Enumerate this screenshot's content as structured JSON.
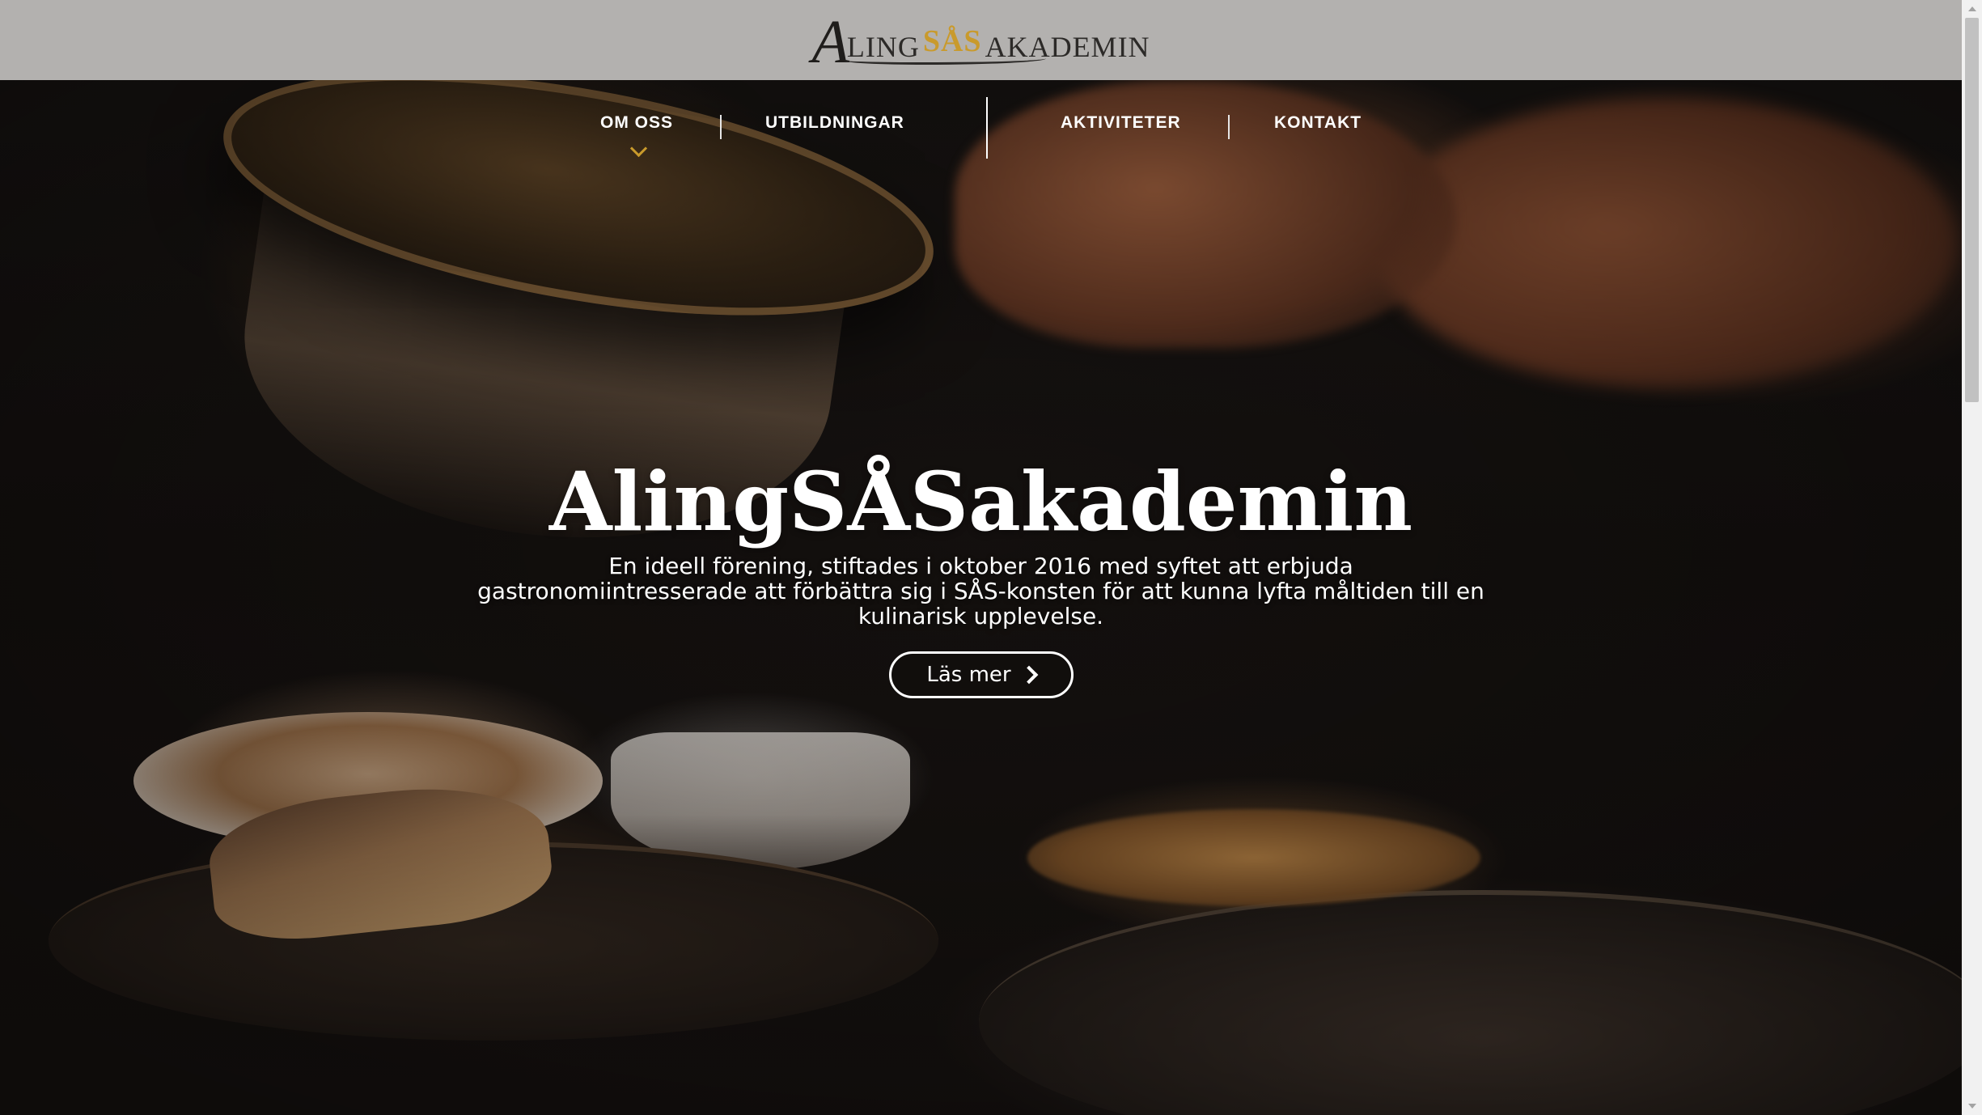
{
  "header": {
    "logo": {
      "letter_a": "A",
      "text_ling": "LING",
      "text_sas": "SÅS",
      "text_akademin": "AKADEMIN"
    }
  },
  "nav": {
    "items": [
      {
        "label": "OM OSS",
        "has_dropdown": true
      },
      {
        "label": "UTBILDNINGAR"
      },
      {
        "label": "AKTIVITETER"
      },
      {
        "label": "KONTAKT"
      }
    ]
  },
  "hero": {
    "title": "AlingSÅSakademin",
    "description": "En ideell förening, stiftades i oktober 2016 med syftet att erbjuda gastronomiintresserade att förbättra sig i SÅS-konsten för att kunna lyfta måltiden till en kulinarisk upplevelse.",
    "button_label": "Läs mer",
    "button_icon": "chevron-right-icon"
  },
  "colors": {
    "header_bg": "#b3b1af",
    "accent_gold": "#c99a2c",
    "text_light": "#ffffff"
  }
}
